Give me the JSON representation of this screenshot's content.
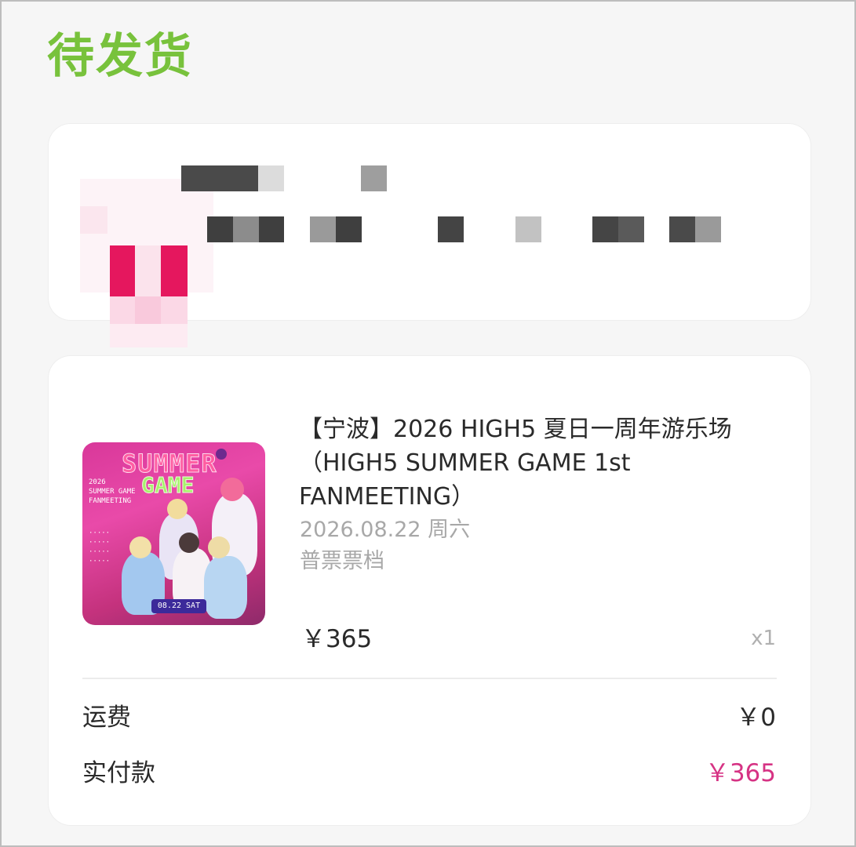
{
  "order_status": "待发货",
  "colors": {
    "status_green": "#78c23c",
    "paid_price_pink": "#d63384",
    "blur_pink": "#e5175e"
  },
  "address_card": {
    "state": "pixelated / obscured"
  },
  "product": {
    "image_icon": "event-poster-thumbnail",
    "poster_text": {
      "line1": "SUMMER",
      "line2": "GAME",
      "badge": "08.22 SAT"
    },
    "title": "【宁波】2026 HIGH5 夏日一周年游乐场（HIGH5 SUMMER GAME 1st FANMEETING）",
    "date": "2026.08.22 周六",
    "tier": "普票票档",
    "price": "￥365",
    "quantity": "x1"
  },
  "summary": {
    "shipping_label": "运费",
    "shipping_value": "￥0",
    "paid_label": "实付款",
    "paid_value": "￥365"
  }
}
